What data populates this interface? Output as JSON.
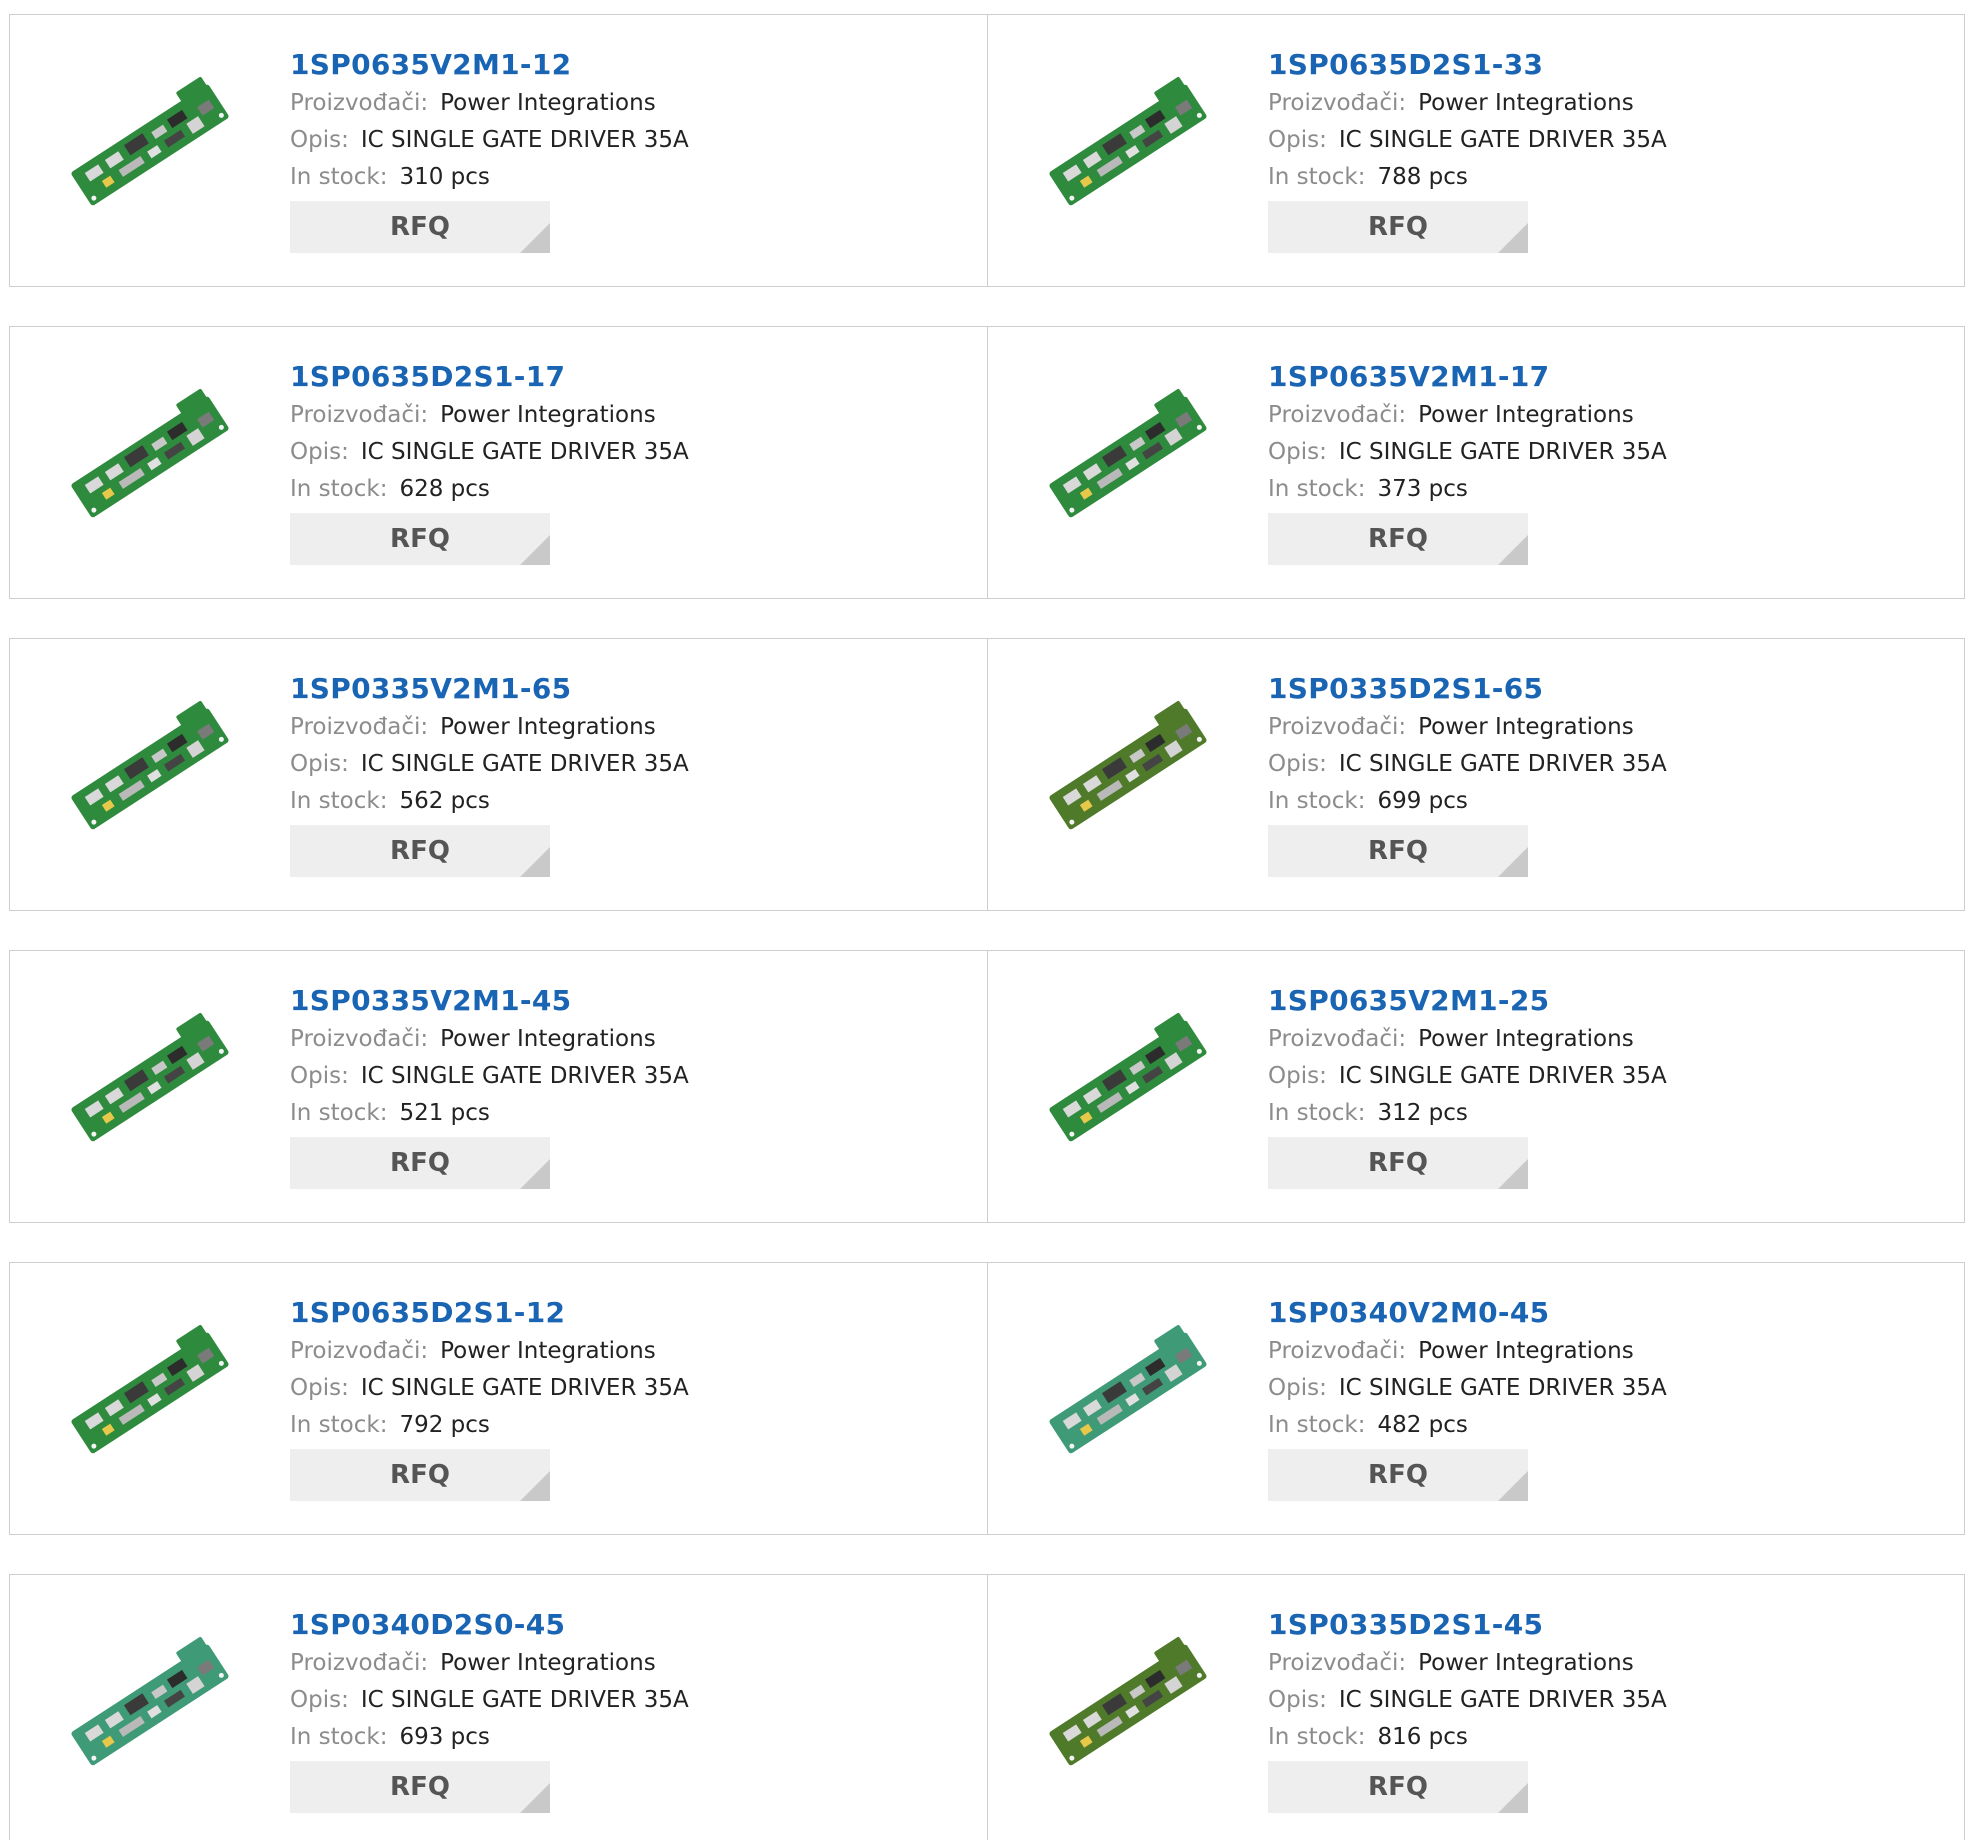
{
  "labels": {
    "manufacturer": "Proizvođači:",
    "description": "Opis:",
    "stock": "In stock:",
    "rfq": "RFQ"
  },
  "colors": {
    "title": "#1a64b4",
    "label": "#8c8c8c",
    "value": "#222222",
    "button_bg": "#eeeeee",
    "button_corner": "#c9c9c9",
    "border": "#cfcfcf"
  },
  "products": [
    {
      "part": "1SP0635V2M1-12",
      "manufacturer": "Power Integrations",
      "description": "IC SINGLE GATE DRIVER 35A",
      "stock": "310 pcs",
      "image": "pcb-board-green"
    },
    {
      "part": "1SP0635D2S1-33",
      "manufacturer": "Power Integrations",
      "description": "IC SINGLE GATE DRIVER 35A",
      "stock": "788 pcs",
      "image": "pcb-board-green"
    },
    {
      "part": "1SP0635D2S1-17",
      "manufacturer": "Power Integrations",
      "description": "IC SINGLE GATE DRIVER 35A",
      "stock": "628 pcs",
      "image": "pcb-board-green"
    },
    {
      "part": "1SP0635V2M1-17",
      "manufacturer": "Power Integrations",
      "description": "IC SINGLE GATE DRIVER 35A",
      "stock": "373 pcs",
      "image": "pcb-board-green"
    },
    {
      "part": "1SP0335V2M1-65",
      "manufacturer": "Power Integrations",
      "description": "IC SINGLE GATE DRIVER 35A",
      "stock": "562 pcs",
      "image": "pcb-board-green"
    },
    {
      "part": "1SP0335D2S1-65",
      "manufacturer": "Power Integrations",
      "description": "IC SINGLE GATE DRIVER 35A",
      "stock": "699 pcs",
      "image": "pcb-board-olive"
    },
    {
      "part": "1SP0335V2M1-45",
      "manufacturer": "Power Integrations",
      "description": "IC SINGLE GATE DRIVER 35A",
      "stock": "521 pcs",
      "image": "pcb-board-green"
    },
    {
      "part": "1SP0635V2M1-25",
      "manufacturer": "Power Integrations",
      "description": "IC SINGLE GATE DRIVER 35A",
      "stock": "312 pcs",
      "image": "pcb-board-green"
    },
    {
      "part": "1SP0635D2S1-12",
      "manufacturer": "Power Integrations",
      "description": "IC SINGLE GATE DRIVER 35A",
      "stock": "792 pcs",
      "image": "pcb-board-green"
    },
    {
      "part": "1SP0340V2M0-45",
      "manufacturer": "Power Integrations",
      "description": "IC SINGLE GATE DRIVER 35A",
      "stock": "482 pcs",
      "image": "pcb-board-teal"
    },
    {
      "part": "1SP0340D2S0-45",
      "manufacturer": "Power Integrations",
      "description": "IC SINGLE GATE DRIVER 35A",
      "stock": "693 pcs",
      "image": "pcb-board-teal"
    },
    {
      "part": "1SP0335D2S1-45",
      "manufacturer": "Power Integrations",
      "description": "IC SINGLE GATE DRIVER 35A",
      "stock": "816 pcs",
      "image": "pcb-board-olive"
    }
  ]
}
